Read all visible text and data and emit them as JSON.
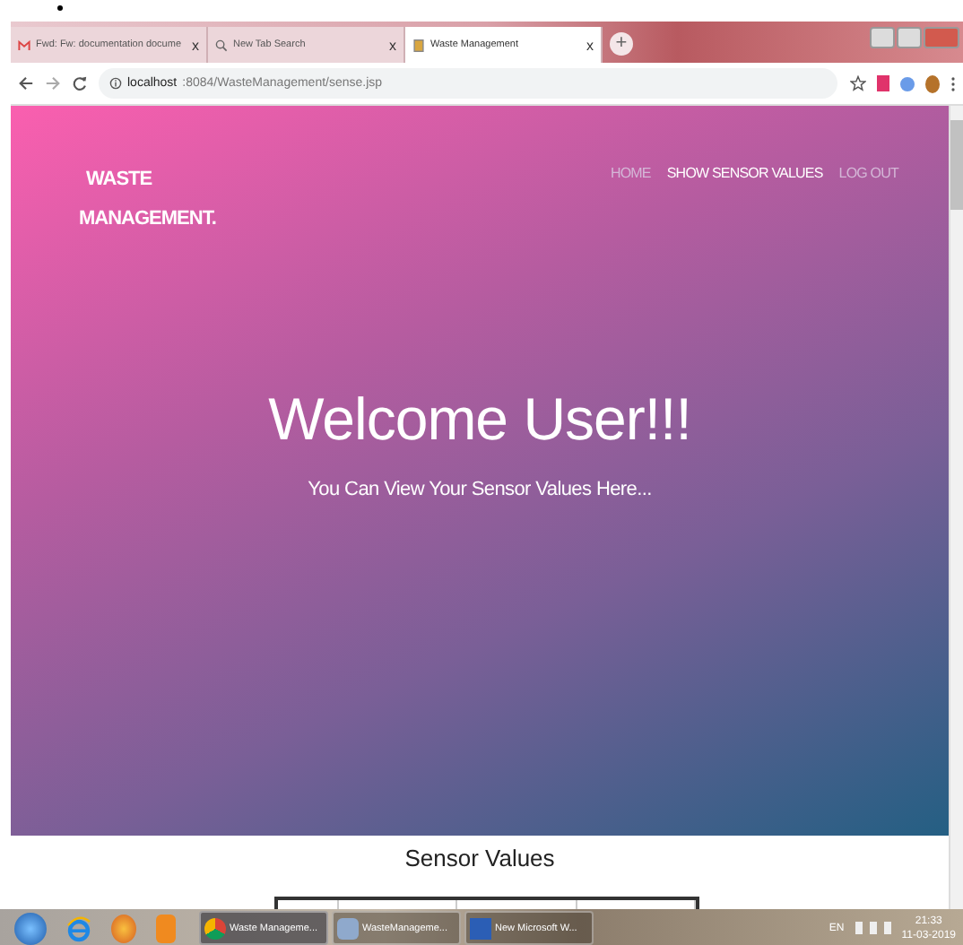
{
  "browser": {
    "tabs": [
      {
        "title": "Fwd: Fw: documentation docume",
        "close": "x",
        "selected": false
      },
      {
        "title": "New Tab Search",
        "close": "x",
        "selected": false
      },
      {
        "title": "Waste Management",
        "close": "x",
        "selected": true
      }
    ],
    "new_tab": "+",
    "url_host": "localhost",
    "url_rest": ":8084/WasteManagement/sense.jsp"
  },
  "page": {
    "brand_lines": [
      "WASTE",
      "MANAGEMENT."
    ],
    "nav": [
      {
        "label": "HOME",
        "selected": false
      },
      {
        "label": "SHOW SENSOR VALUES",
        "selected": true
      },
      {
        "label": "LOG OUT",
        "selected": false
      }
    ],
    "heading": "Welcome User!!!",
    "subheading": "You Can View Your Sensor Values Here...",
    "section_title": "Sensor Values"
  },
  "taskbar": {
    "tasks": [
      {
        "label": "Waste Manageme...",
        "selected": true
      },
      {
        "label": "WasteManageme...",
        "selected": false
      },
      {
        "label": "New Microsoft W...",
        "selected": false
      }
    ],
    "language": "EN",
    "time": "21:33",
    "date": "11-03-2019"
  }
}
